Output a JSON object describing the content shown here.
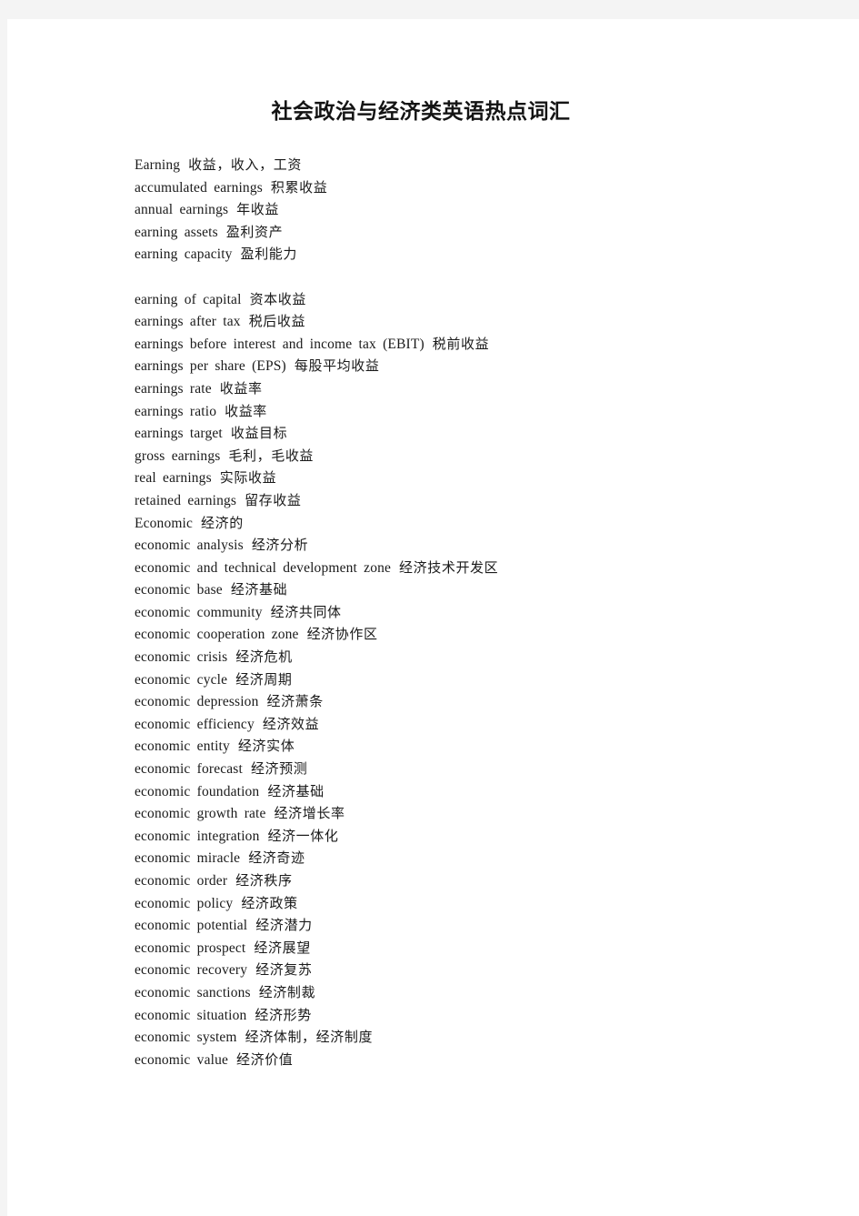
{
  "document": {
    "title": "社会政治与经济类英语热点词汇",
    "page_background": "#ffffff",
    "canvas_background": "#f4f4f4",
    "text_color": "#1a1a1a"
  },
  "entries": [
    {
      "en": "Earning",
      "zh": "收益，收入，工资"
    },
    {
      "en": "accumulated earnings",
      "zh": "积累收益"
    },
    {
      "en": "annual earnings",
      "zh": "年收益"
    },
    {
      "en": "earning assets",
      "zh": "盈利资产"
    },
    {
      "en": "earning capacity",
      "zh": "盈利能力"
    },
    {
      "blank": true
    },
    {
      "en": "earning of capital",
      "zh": "资本收益"
    },
    {
      "en": "earnings after tax",
      "zh": "税后收益"
    },
    {
      "en": "earnings before interest and income tax (EBIT)",
      "zh": "税前收益"
    },
    {
      "en": "earnings per share (EPS)",
      "zh": "每股平均收益"
    },
    {
      "en": "earnings rate",
      "zh": "收益率"
    },
    {
      "en": "earnings ratio",
      "zh": "收益率"
    },
    {
      "en": "earnings target",
      "zh": "收益目标"
    },
    {
      "en": "gross earnings",
      "zh": "毛利，毛收益"
    },
    {
      "en": "real earnings",
      "zh": "实际收益"
    },
    {
      "en": "retained earnings",
      "zh": "留存收益"
    },
    {
      "en": "Economic",
      "zh": "经济的"
    },
    {
      "en": "economic analysis",
      "zh": "经济分析"
    },
    {
      "en": "economic and technical development zone",
      "zh": "经济技术开发区"
    },
    {
      "en": "economic base",
      "zh": "经济基础"
    },
    {
      "en": "economic community",
      "zh": "经济共同体"
    },
    {
      "en": "economic cooperation zone",
      "zh": "经济协作区"
    },
    {
      "en": "economic crisis",
      "zh": "经济危机"
    },
    {
      "en": "economic cycle",
      "zh": "经济周期"
    },
    {
      "en": "economic depression",
      "zh": "经济萧条"
    },
    {
      "en": "economic efficiency",
      "zh": "经济效益"
    },
    {
      "en": "economic entity",
      "zh": "经济实体"
    },
    {
      "en": "economic forecast",
      "zh": "经济预测"
    },
    {
      "en": "economic foundation",
      "zh": "经济基础"
    },
    {
      "en": "economic growth rate",
      "zh": "经济增长率"
    },
    {
      "en": "economic integration",
      "zh": "经济一体化"
    },
    {
      "en": "economic miracle",
      "zh": "经济奇迹"
    },
    {
      "en": "economic order",
      "zh": "经济秩序"
    },
    {
      "en": "economic policy",
      "zh": "经济政策"
    },
    {
      "en": "economic potential",
      "zh": "经济潜力"
    },
    {
      "en": "economic prospect",
      "zh": "经济展望"
    },
    {
      "en": "economic recovery",
      "zh": "经济复苏"
    },
    {
      "en": "economic sanctions",
      "zh": "经济制裁"
    },
    {
      "en": "economic situation",
      "zh": "经济形势"
    },
    {
      "en": "economic system",
      "zh": "经济体制，经济制度"
    },
    {
      "en": "economic value",
      "zh": "经济价值"
    }
  ]
}
